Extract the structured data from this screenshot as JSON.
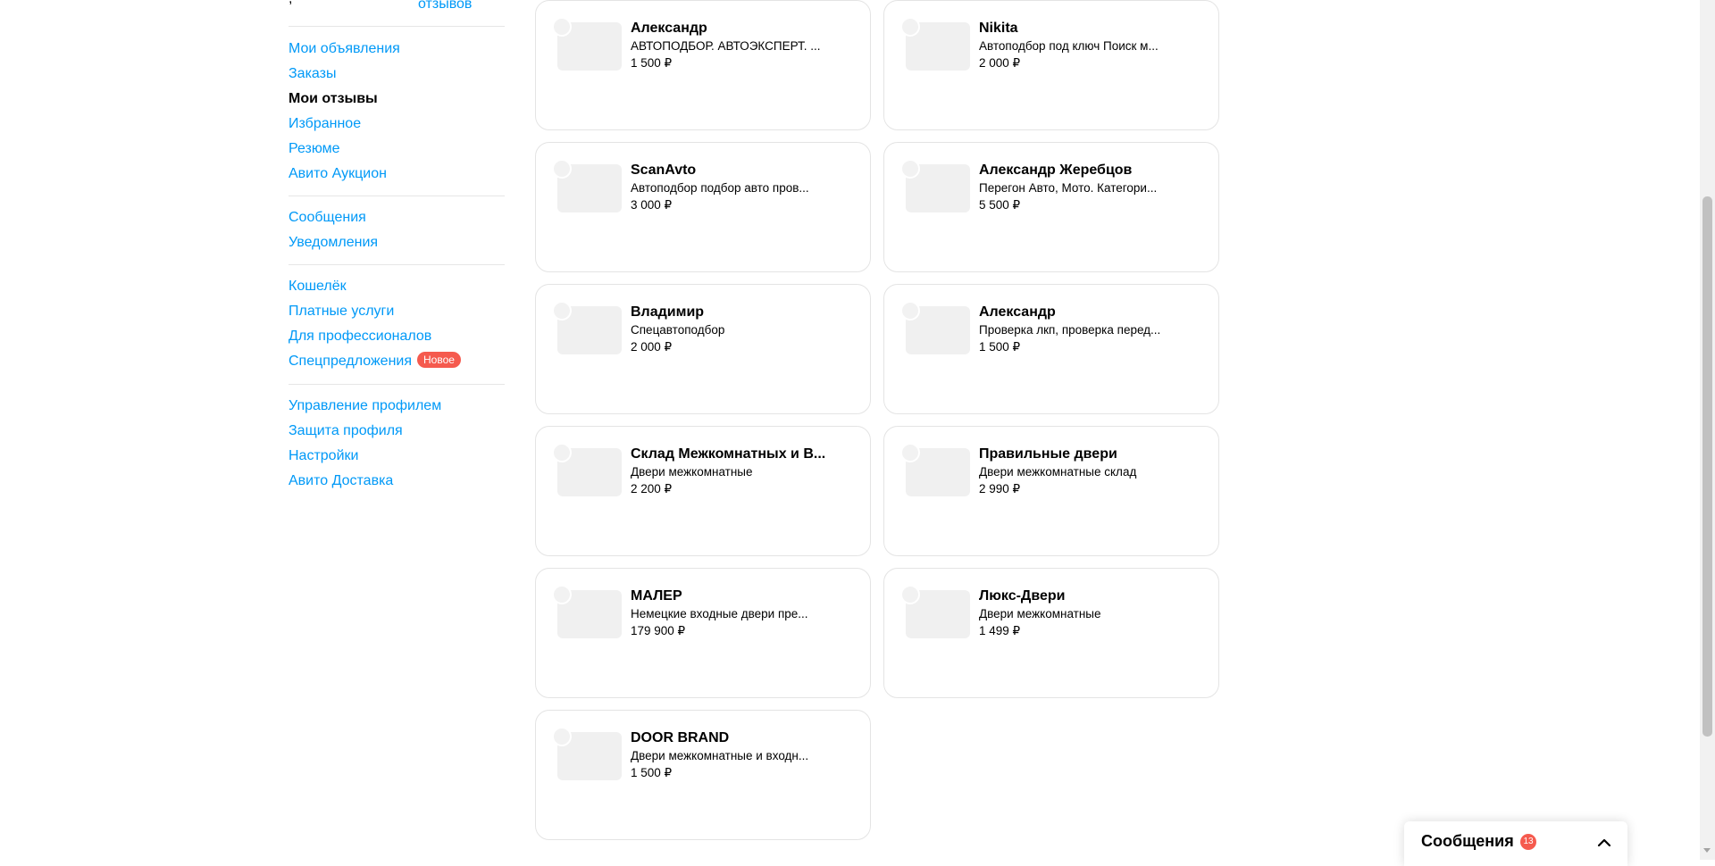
{
  "sidebar": {
    "top_link": "отзывов",
    "groups": [
      {
        "items": [
          {
            "label": "Мои объявления",
            "active": false
          },
          {
            "label": "Заказы",
            "active": false
          },
          {
            "label": "Мои отзывы",
            "active": true
          },
          {
            "label": "Избранное",
            "active": false
          },
          {
            "label": "Резюме",
            "active": false
          },
          {
            "label": "Авито Аукцион",
            "active": false
          }
        ]
      },
      {
        "items": [
          {
            "label": "Сообщения"
          },
          {
            "label": "Уведомления"
          }
        ]
      },
      {
        "items": [
          {
            "label": "Кошелёк"
          },
          {
            "label": "Платные услуги"
          },
          {
            "label": "Для профессионалов"
          },
          {
            "label": "Спецпредложения",
            "badge": "Новое"
          }
        ]
      },
      {
        "items": [
          {
            "label": "Управление профилем"
          },
          {
            "label": "Защита профиля"
          },
          {
            "label": "Настройки"
          },
          {
            "label": "Авито Доставка"
          }
        ]
      }
    ]
  },
  "cards": [
    {
      "name": "Александр",
      "description": "АВТОПОДБОР. АВТОЭКСПЕРТ. ...",
      "price": "1 500 ₽"
    },
    {
      "name": "Nikita",
      "description": "Автоподбор под ключ Поиск м...",
      "price": "2 000 ₽"
    },
    {
      "name": "ScanAvto",
      "description": "Автоподбор подбор авто пров...",
      "price": "3 000 ₽"
    },
    {
      "name": "Александр Жеребцов",
      "description": "Перегон Авто, Мото. Категори...",
      "price": "5 500 ₽"
    },
    {
      "name": "Владимир",
      "description": "Спецавтоподбор",
      "price": "2 000 ₽"
    },
    {
      "name": "Александр",
      "description": "Проверка лкп, проверка перед...",
      "price": "1 500 ₽"
    },
    {
      "name": "Склад Межкомнатных и В...",
      "description": "Двери межкомнатные",
      "price": "2 200 ₽"
    },
    {
      "name": "Правильные двери",
      "description": "Двери межкомнатные склад",
      "price": "2 990 ₽"
    },
    {
      "name": "МАЛЕР",
      "description": "Немецкие входные двери пре...",
      "price": "179 900 ₽"
    },
    {
      "name": "Люкс-Двери",
      "description": "Двери межкомнатные",
      "price": "1 499 ₽"
    },
    {
      "name": "DOOR BRAND",
      "description": "Двери межкомнатные и входн...",
      "price": "1 500 ₽"
    }
  ],
  "messages_panel": {
    "title": "Сообщения",
    "count": "13",
    "icon": "chevron-up-icon"
  },
  "colors": {
    "link": "#0099f7",
    "badge": "#f55a4e"
  }
}
